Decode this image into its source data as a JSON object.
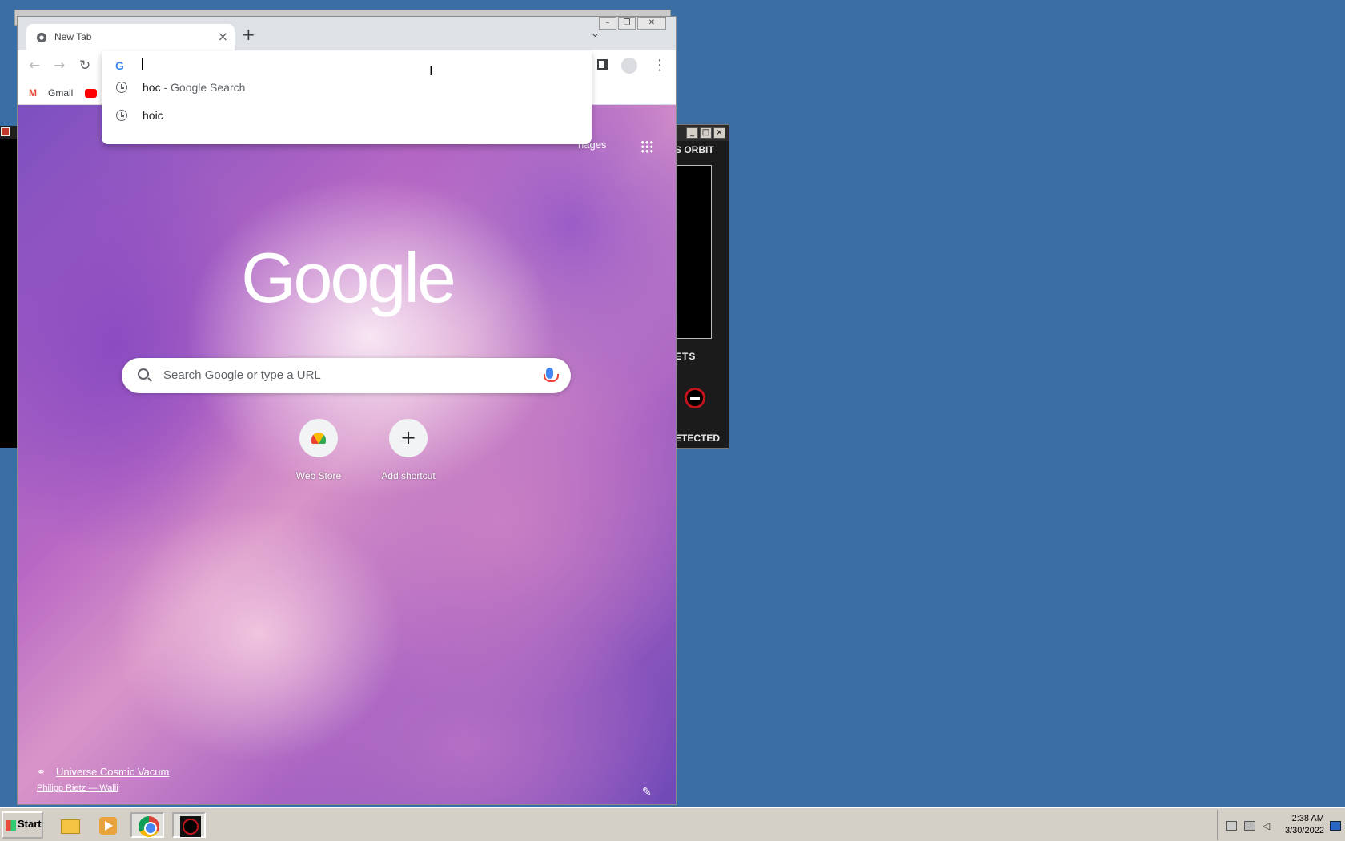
{
  "chrome": {
    "tab_title": "New Tab",
    "new_tab_symbol": "+",
    "tab_close_symbol": "×",
    "tab_search_symbol": "⌄",
    "back_symbol": "←",
    "forward_symbol": "→",
    "reload_symbol": "↻",
    "menu_symbol": "⋮",
    "bookmarks": [
      {
        "label": "Gmail",
        "icon": "gmail-icon"
      },
      {
        "label": "",
        "icon": "youtube-icon"
      }
    ]
  },
  "omnibox": {
    "value": "",
    "suggestions": [
      {
        "query": "hoc",
        "suffix": " - Google Search",
        "icon": "history-clock-icon"
      },
      {
        "query": "hoic",
        "suffix": "",
        "icon": "history-clock-icon"
      }
    ]
  },
  "ntp": {
    "top_link": "nages",
    "logo": "Google",
    "search_placeholder": "Search Google or type a URL",
    "shortcuts": [
      {
        "label": "Web Store",
        "icon": "web-store-icon"
      },
      {
        "label": "Add shortcut",
        "icon": "plus-icon"
      }
    ],
    "attribution_title": "Universe Cosmic Vacum",
    "attribution_author": "Philipp Rietz — Walli",
    "link_symbol": "⚭",
    "edit_symbol": "✎"
  },
  "hoic_window": {
    "orbit_label": "S ORBIT",
    "targets_label": "ETS",
    "status_label": "ETECTED",
    "accent_color": "#c0141d"
  },
  "taskbar": {
    "start_label": "Start",
    "time": "2:38 AM",
    "date": "3/30/2022",
    "apps": [
      "folder-icon",
      "media-player-icon",
      "chrome-icon",
      "hoic-icon"
    ]
  },
  "colors": {
    "desktop": "#3a6ea5",
    "google_blue": "#4285f4"
  }
}
